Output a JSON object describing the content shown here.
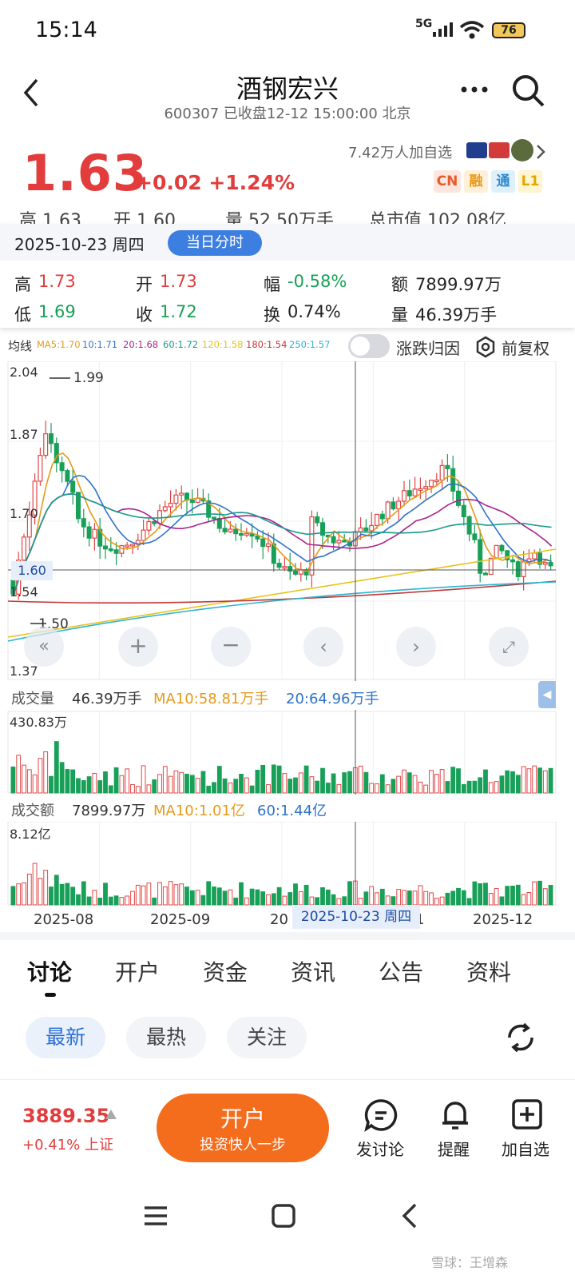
{
  "status": {
    "time": "15:14",
    "network": "5G",
    "battery": "76"
  },
  "header": {
    "title": "酒钢宏兴",
    "subtitle": "600307 已收盘12-12 15:00:00 北京"
  },
  "quote": {
    "price": "1.63",
    "change": "+0.02 +1.24%",
    "followers": "7.42万人加自选",
    "badges": [
      "CN",
      "融",
      "通",
      "L1"
    ],
    "hidden_row": [
      "高 1.63",
      "开 1.60",
      "量 52.50万手",
      "总市值 102.08亿"
    ]
  },
  "popup": {
    "date": "2025-10-23 周四",
    "button": "当日分时",
    "cells": {
      "high_label": "高",
      "high": "1.73",
      "open_label": "开",
      "open": "1.73",
      "amp_label": "幅",
      "amp": "-0.58%",
      "amount_label": "额",
      "amount": "7899.97万",
      "low_label": "低",
      "low": "1.69",
      "close_label": "收",
      "close": "1.72",
      "turnover_label": "换",
      "turnover": "0.74%",
      "volume_label": "量",
      "volume": "46.39万手"
    }
  },
  "ma_legend": {
    "title": "均线",
    "items": [
      {
        "text": "MA5:1.70",
        "color": "#e69a1b"
      },
      {
        "text": "10:1.71",
        "color": "#2f73c9"
      },
      {
        "text": "20:1.68",
        "color": "#a8228f"
      },
      {
        "text": "60:1.72",
        "color": "#1a9b8a"
      },
      {
        "text": "120:1.58",
        "color": "#e8c21a"
      },
      {
        "text": "180:1.54",
        "color": "#c43838"
      },
      {
        "text": "250:1.57",
        "color": "#2bb5d0"
      }
    ],
    "toggle_label": "涨跌归因",
    "restore_label": "前复权"
  },
  "chart_data": {
    "type": "candlestick",
    "ylim": [
      1.37,
      2.04
    ],
    "y_ticks": [
      "2.04",
      "1.87",
      "1.70",
      "1.54",
      "1.37"
    ],
    "max_marker": "1.99",
    "min_marker": "1.50",
    "crosshair_price": "1.60",
    "crosshair_date": "2025-10-23 周四",
    "x_labels": [
      "2025-08",
      "2025-09",
      "20",
      "1",
      "2025-12"
    ],
    "volume": {
      "label": "成交量",
      "value": "46.39万手",
      "ma10": "MA10:58.81万手",
      "ma20": "20:64.96万手",
      "max": "430.83万"
    },
    "amount": {
      "label": "成交额",
      "value": "7899.97万",
      "ma10": "MA10:1.01亿",
      "ma60": "60:1.44亿",
      "max": "8.12亿"
    }
  },
  "tabs": [
    "讨论",
    "开户",
    "资金",
    "资讯",
    "公告",
    "资料"
  ],
  "filters": [
    "最新",
    "最热",
    "关注"
  ],
  "bottom": {
    "index_value": "3889.35",
    "index_change": "+0.41% 上证",
    "open_title": "开户",
    "open_sub": "投资快人一步",
    "actions": [
      "发讨论",
      "提醒",
      "加自选"
    ]
  },
  "watermark": "雪球：王增森"
}
